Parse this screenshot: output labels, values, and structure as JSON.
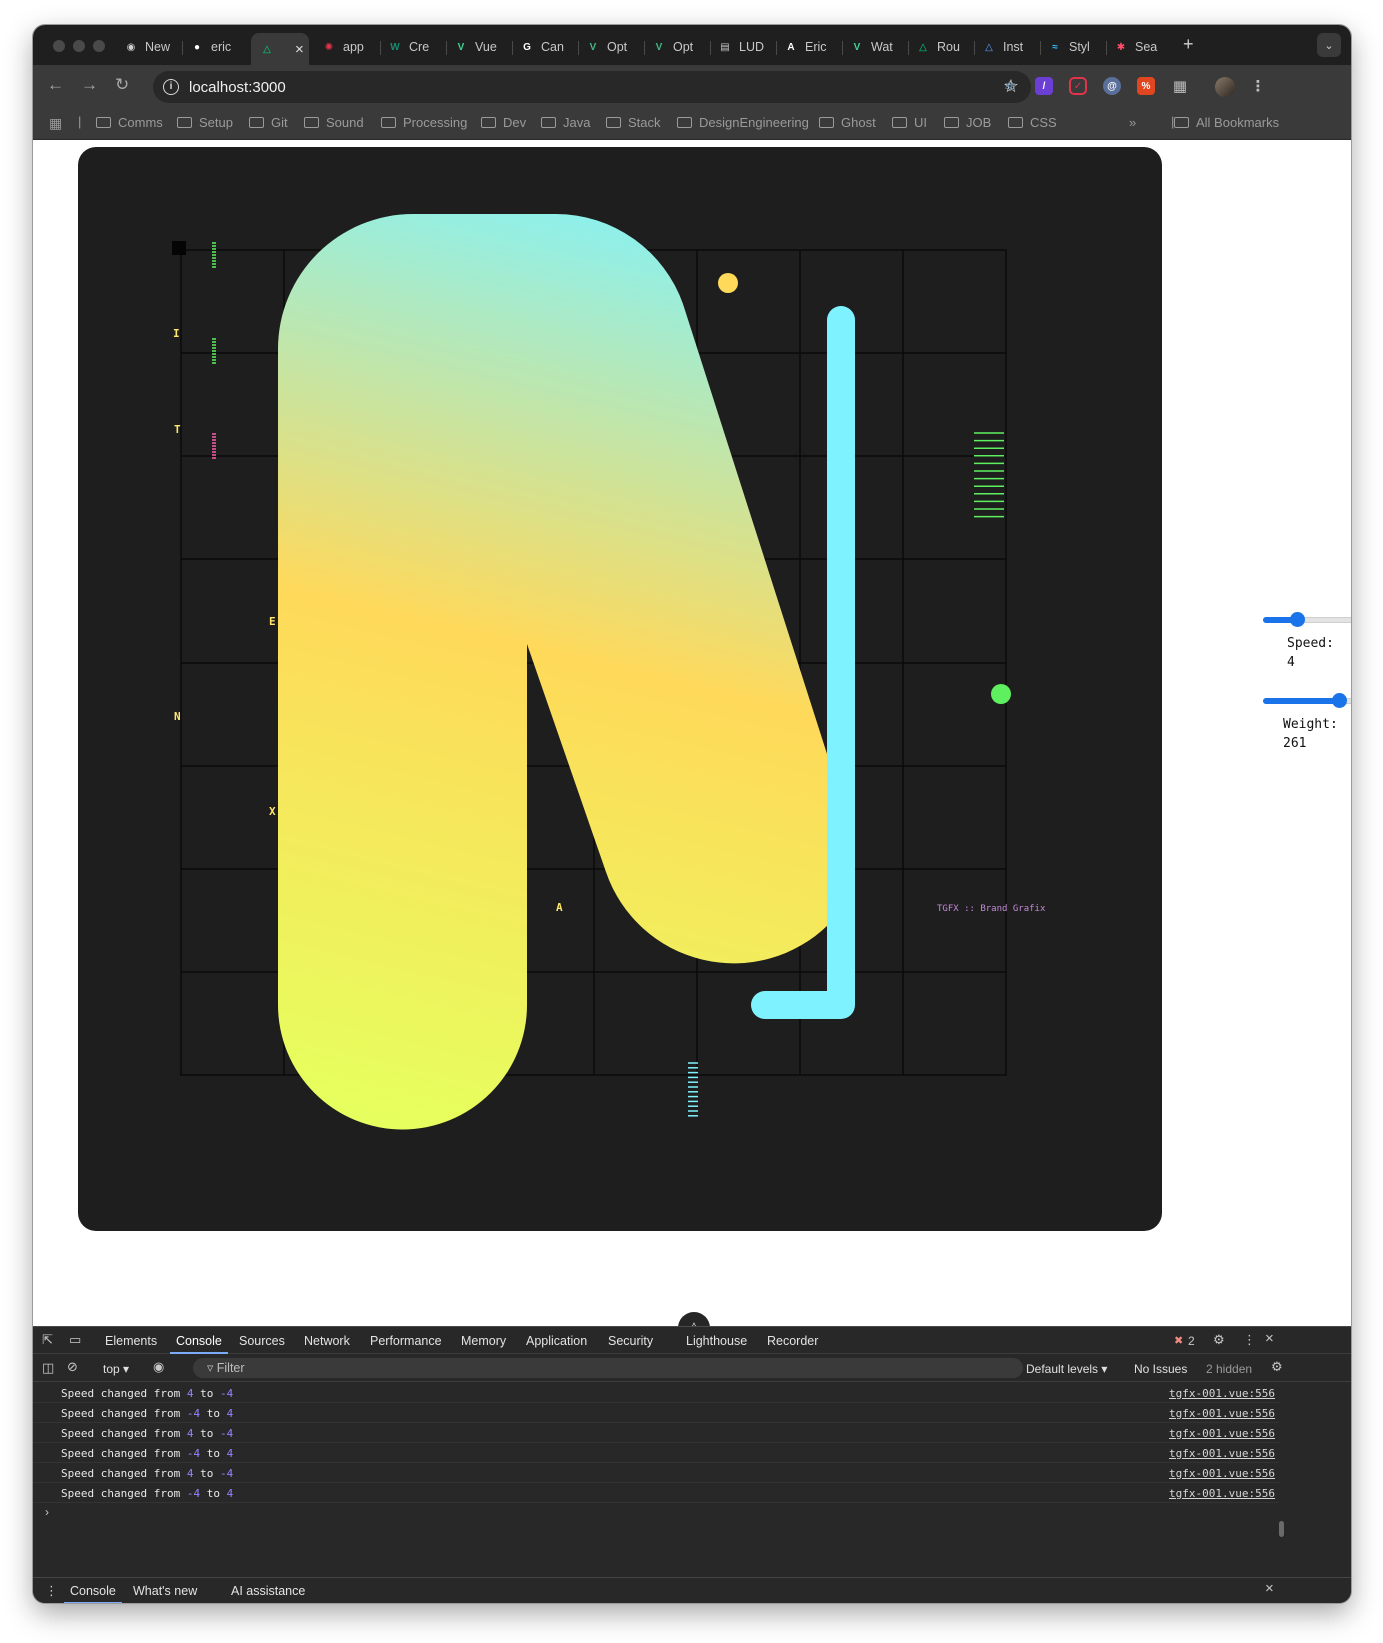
{
  "browser": {
    "tabs": [
      {
        "label": "New",
        "icon": "globe-icon",
        "color": "#cfcfcf"
      },
      {
        "label": "eric",
        "icon": "github-icon",
        "color": "#ffffff"
      },
      {
        "label": "",
        "icon": "nuxt-icon",
        "color": "#00dc82",
        "active": true
      },
      {
        "label": "app",
        "icon": "settings-badge-icon",
        "color": "#e5334b"
      },
      {
        "label": "Cre",
        "icon": "vue-square-icon",
        "color": "#1a8a6e"
      },
      {
        "label": "Vue",
        "icon": "vue-icon",
        "color": "#42d392"
      },
      {
        "label": "Can",
        "icon": "google-icon",
        "color": "#ffffff"
      },
      {
        "label": "Opt",
        "icon": "vue-circle-icon",
        "color": "#42b883"
      },
      {
        "label": "Opt",
        "icon": "vue-circle-icon",
        "color": "#42b883"
      },
      {
        "label": "LUD",
        "icon": "document-icon",
        "color": "#c8c8c8"
      },
      {
        "label": "Eric",
        "icon": "a-letter-icon",
        "color": "#ffffff"
      },
      {
        "label": "Wat",
        "icon": "vue-icon",
        "color": "#42d392"
      },
      {
        "label": "Rou",
        "icon": "nuxt-icon",
        "color": "#00dc82"
      },
      {
        "label": "Inst",
        "icon": "nuxt-outline-icon",
        "color": "#5aa0ff"
      },
      {
        "label": "Styl",
        "icon": "tailwind-icon",
        "color": "#38bdf8"
      },
      {
        "label": "Sea",
        "icon": "star-burst-icon",
        "color": "#ff4d6d"
      }
    ],
    "url": "localhost:3000",
    "bookmarks": [
      "Comms",
      "Setup",
      "Git",
      "Sound",
      "Processing",
      "Dev",
      "Java",
      "Stack",
      "DesignEngineering",
      "Ghost",
      "UI",
      "JOB",
      "CSS"
    ],
    "all_bookmarks": "All Bookmarks",
    "new_tab": "+",
    "overflow": "»"
  },
  "artwork": {
    "letters": [
      "I",
      "T",
      "E",
      "N",
      "X",
      "A"
    ],
    "brand": "TGFX :: Brand Grafix",
    "gradient": [
      "#7ef3ff",
      "#ffd95a",
      "#e6ff5e"
    ],
    "accent_cyan": "#7ef3ff",
    "accent_yellow": "#ffd95a",
    "accent_green": "#5ef05e",
    "tick_green": "#5ef05e",
    "tick_pink": "#ff5ea8",
    "tick_cyan": "#7ef3ff"
  },
  "controls": {
    "speed_label": "Speed:",
    "speed_value": "4",
    "speed_fraction": 0.35,
    "weight_label": "Weight:",
    "weight_value": "261",
    "weight_fraction": 0.78
  },
  "devtools": {
    "tabs": [
      "Elements",
      "Console",
      "Sources",
      "Network",
      "Performance",
      "Memory",
      "Application",
      "Security",
      "Lighthouse",
      "Recorder"
    ],
    "active_tab": "Console",
    "error_count": "2",
    "context": "top",
    "filter_placeholder": "Filter",
    "levels": "Default levels",
    "issues": "No Issues",
    "hidden": "2 hidden",
    "logs": [
      {
        "from": "4",
        "to": "-4",
        "source": "tgfx-001.vue:556"
      },
      {
        "from": "-4",
        "to": "4",
        "source": "tgfx-001.vue:556"
      },
      {
        "from": "4",
        "to": "-4",
        "source": "tgfx-001.vue:556"
      },
      {
        "from": "-4",
        "to": "4",
        "source": "tgfx-001.vue:556"
      },
      {
        "from": "4",
        "to": "-4",
        "source": "tgfx-001.vue:556"
      },
      {
        "from": "-4",
        "to": "4",
        "source": "tgfx-001.vue:556"
      }
    ],
    "log_prefix": "Speed changed from",
    "log_mid": "to",
    "drawer_tabs": [
      "Console",
      "What's new",
      "AI assistance"
    ]
  }
}
